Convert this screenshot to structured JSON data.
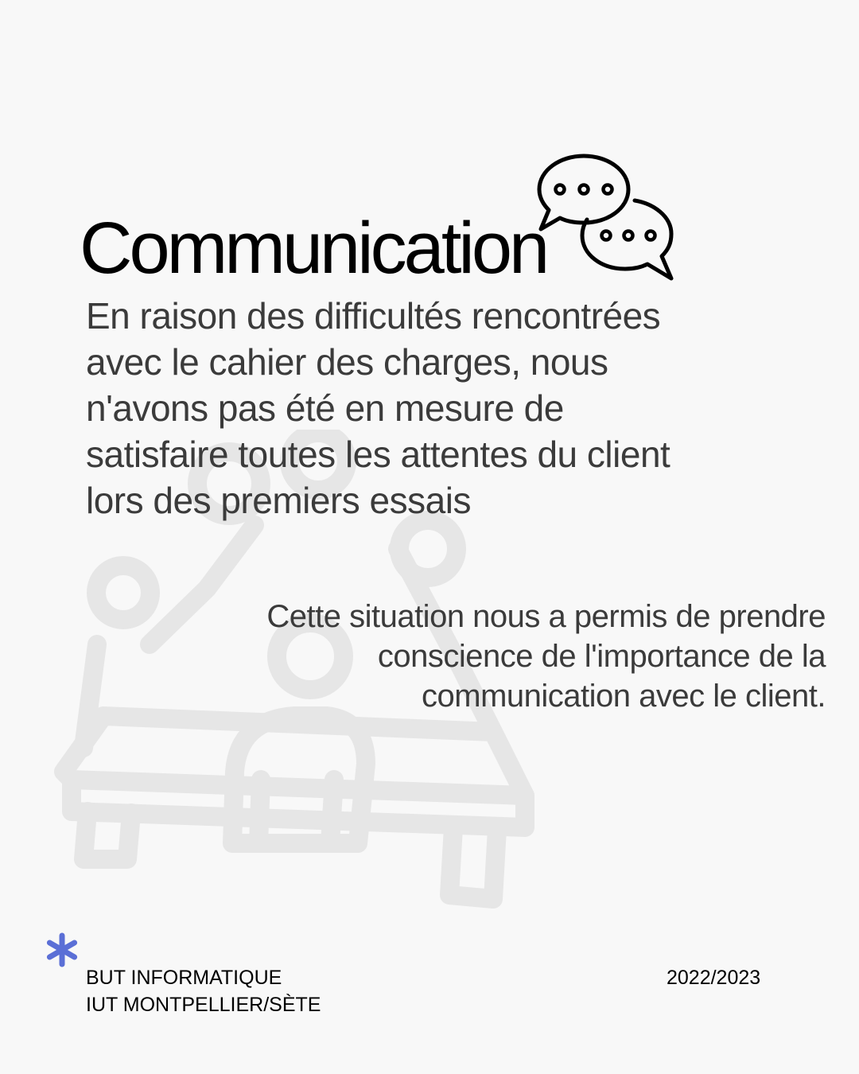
{
  "title": "Communication",
  "paragraph_main": "En raison des difficultés rencontrées avec le cahier des charges, nous n'avons pas été en mesure de satisfaire toutes les attentes du client lors des premiers essais",
  "paragraph_secondary": "Cette situation nous a permis de prendre conscience de l'importance de la communication avec le client.",
  "footer": {
    "line1": "BUT INFORMATIQUE",
    "line2": "IUT MONTPELLIER/SÈTE",
    "year": "2022/2023"
  },
  "icons": {
    "chat": "chat-bubbles-icon",
    "background": "meeting-table-people-icon",
    "decoration": "asterisk-icon"
  },
  "colors": {
    "background": "#f8f8f8",
    "title": "#000000",
    "body_text": "#3b3b3b",
    "illustration": "#e5e5e5",
    "asterisk": "#5b6fd6"
  }
}
